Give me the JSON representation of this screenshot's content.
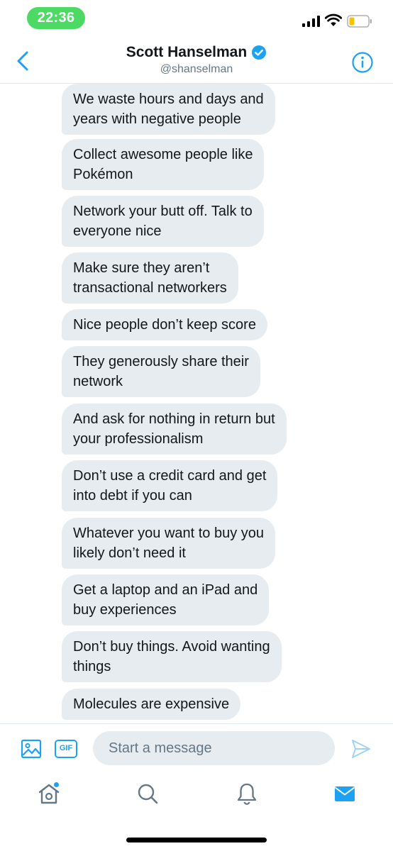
{
  "status_bar": {
    "time": "22:36"
  },
  "header": {
    "name": "Scott Hanselman",
    "handle": "@shanselman",
    "back_icon": "chevron-left-icon",
    "verified_icon": "verified-badge-icon",
    "info_icon": "info-icon"
  },
  "messages": [
    "We waste hours and days and\nyears with negative people",
    "Collect awesome people like\nPokémon",
    "Network your butt off. Talk to\neveryone nice",
    "Make sure they aren’t\ntransactional networkers",
    "Nice people don’t keep score",
    "They generously share their\nnetwork",
    "And ask for nothing in return but\nyour professionalism",
    "Don’t use a credit card and get\ninto debt if you can",
    "Whatever you want to buy you\nlikely don’t need it",
    "Get a laptop and an iPad and\nbuy experiences",
    "Don’t buy things. Avoid wanting\nthings",
    "Molecules are expensive"
  ],
  "compose": {
    "gif_label": "GIF",
    "placeholder": "Start a message"
  },
  "tabs": [
    "home-icon",
    "search-icon",
    "notifications-bell-icon",
    "messages-envelope-icon"
  ],
  "colors": {
    "accent": "#1da1f2",
    "bubble": "#e6ecf0",
    "time_pill": "#4cd964"
  }
}
